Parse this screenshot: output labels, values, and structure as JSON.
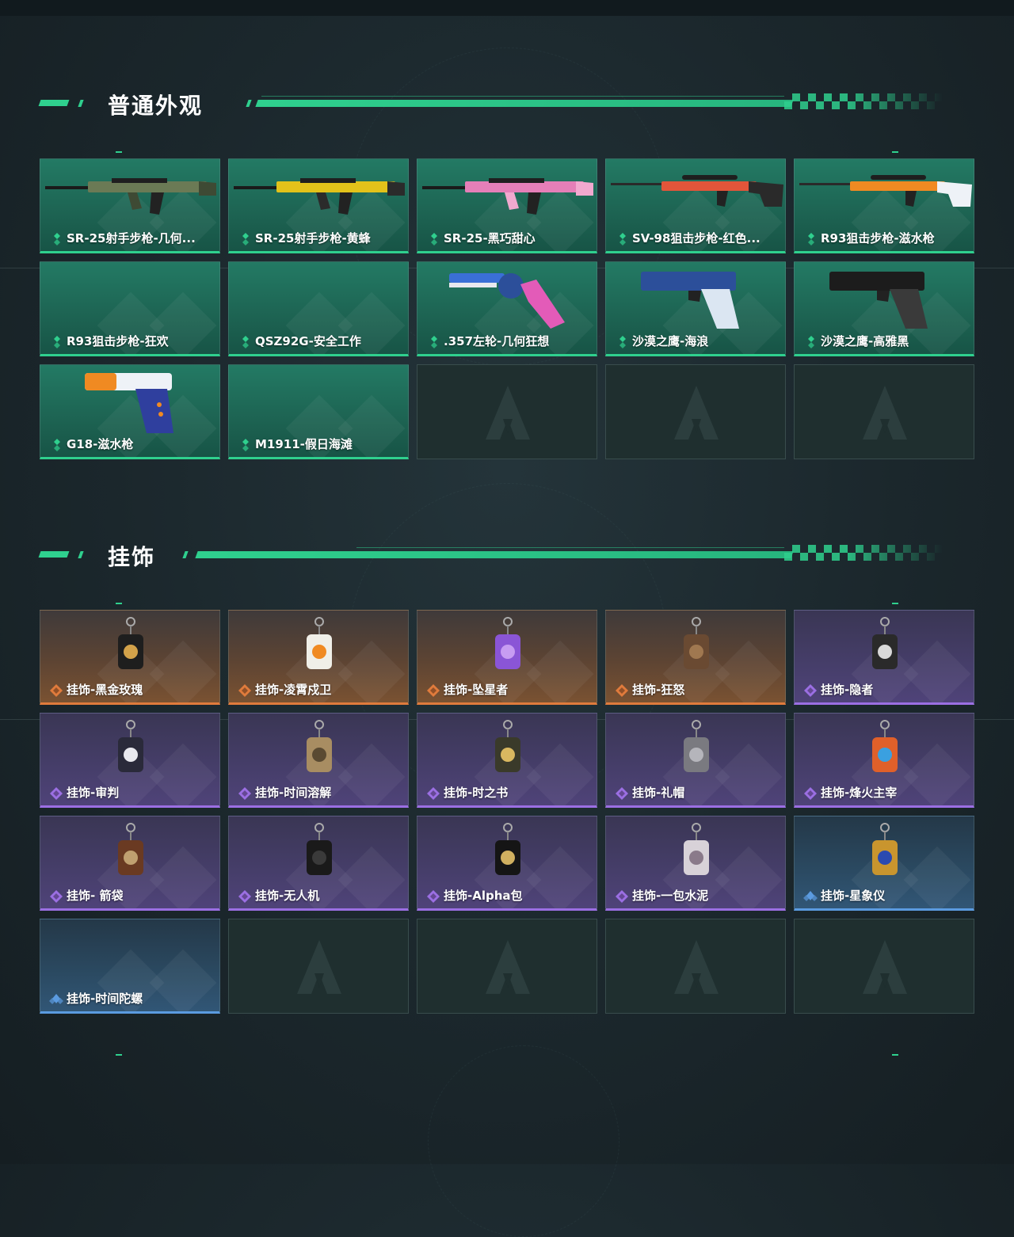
{
  "sections": [
    {
      "title": "普通外观",
      "items": [
        {
          "label": "SR-25射手步枪-几何...",
          "rarity": "green",
          "icon": "rifle-camo-icon",
          "art": "rifle",
          "colors": [
            "#6b7a55",
            "#3e4a34"
          ]
        },
        {
          "label": "SR-25射手步枪-黄蜂",
          "rarity": "green",
          "icon": "rifle-wasp-icon",
          "art": "rifle",
          "colors": [
            "#e3c21a",
            "#2b2b2b"
          ]
        },
        {
          "label": "SR-25-黑巧甜心",
          "rarity": "green",
          "icon": "rifle-pink-icon",
          "art": "rifle",
          "colors": [
            "#e57fb8",
            "#f2a9cf"
          ]
        },
        {
          "label": "SV-98狙击步枪-红色...",
          "rarity": "green",
          "icon": "sniper-red-icon",
          "art": "sniper",
          "colors": [
            "#e2553a",
            "#2a2a2a"
          ]
        },
        {
          "label": "R93狙击步枪-滋水枪",
          "rarity": "green",
          "icon": "sniper-water-icon",
          "art": "sniper",
          "colors": [
            "#f08a22",
            "#eef2f7"
          ]
        },
        {
          "label": "R93狙击步枪-狂欢",
          "rarity": "green",
          "icon": "sniper-carnival-icon",
          "art": "none",
          "colors": [
            "#000000",
            "#000000"
          ]
        },
        {
          "label": "QSZ92G-安全工作",
          "rarity": "green",
          "icon": "pistol-safety-icon",
          "art": "none",
          "colors": [
            "#000000",
            "#000000"
          ]
        },
        {
          "label": ".357左轮-几何狂想",
          "rarity": "green",
          "icon": "revolver-geometric-icon",
          "art": "revolver",
          "colors": [
            "#3a6fd6",
            "#e35bb8"
          ]
        },
        {
          "label": "沙漠之鹰-海浪",
          "rarity": "green",
          "icon": "deagle-wave-icon",
          "art": "pistol",
          "colors": [
            "#2c4f9a",
            "#dbe6f2"
          ]
        },
        {
          "label": "沙漠之鹰-高雅黑",
          "rarity": "green",
          "icon": "deagle-black-icon",
          "art": "pistol",
          "colors": [
            "#1c1c1c",
            "#3a3a3a"
          ]
        },
        {
          "label": "G18-滋水枪",
          "rarity": "green",
          "icon": "glock-water-icon",
          "art": "glock",
          "colors": [
            "#2f3f9e",
            "#f08a22"
          ]
        },
        {
          "label": "M1911-假日海滩",
          "rarity": "green",
          "icon": "m1911-beach-icon",
          "art": "none",
          "colors": [
            "#000000",
            "#000000"
          ]
        },
        {
          "label": "",
          "rarity": "empty",
          "icon": "empty-slot-icon",
          "art": "empty",
          "colors": [
            "#000000",
            "#000000"
          ]
        },
        {
          "label": "",
          "rarity": "empty",
          "icon": "empty-slot-icon",
          "art": "empty",
          "colors": [
            "#000000",
            "#000000"
          ]
        },
        {
          "label": "",
          "rarity": "empty",
          "icon": "empty-slot-icon",
          "art": "empty",
          "colors": [
            "#000000",
            "#000000"
          ]
        }
      ]
    },
    {
      "title": "挂饰",
      "items": [
        {
          "label": "挂饰-黑金玫瑰",
          "rarity": "orange",
          "icon": "charm-black-gold-rose-icon",
          "art": "charm",
          "colors": [
            "#1e1e1e",
            "#d3a24a"
          ]
        },
        {
          "label": "挂饰-凌霄戍卫",
          "rarity": "orange",
          "icon": "charm-guardian-icon",
          "art": "charm",
          "colors": [
            "#f0efe8",
            "#f08a22"
          ]
        },
        {
          "label": "挂饰-坠星者",
          "rarity": "orange",
          "icon": "charm-fallen-star-icon",
          "art": "charm",
          "colors": [
            "#8a55d6",
            "#c79cf2"
          ]
        },
        {
          "label": "挂饰-狂怒",
          "rarity": "orange",
          "icon": "charm-fury-icon",
          "art": "charm",
          "colors": [
            "#6a4a32",
            "#a07850"
          ]
        },
        {
          "label": "挂饰-隐者",
          "rarity": "purple",
          "icon": "charm-hermit-icon",
          "art": "charm",
          "colors": [
            "#2a2a2a",
            "#d9d9d9"
          ]
        },
        {
          "label": "挂饰-审判",
          "rarity": "purple",
          "icon": "charm-judgment-icon",
          "art": "charm",
          "colors": [
            "#2a2a3a",
            "#e8e8ee"
          ]
        },
        {
          "label": "挂饰-时间溶解",
          "rarity": "purple",
          "icon": "charm-time-dissolve-icon",
          "art": "charm",
          "colors": [
            "#a88d62",
            "#5a4a32"
          ]
        },
        {
          "label": "挂饰-时之书",
          "rarity": "purple",
          "icon": "charm-book-of-time-icon",
          "art": "charm",
          "colors": [
            "#3a3a2a",
            "#d9b860"
          ]
        },
        {
          "label": "挂饰-礼帽",
          "rarity": "purple",
          "icon": "charm-top-hat-icon",
          "art": "charm",
          "colors": [
            "#7a7a80",
            "#b5b5bb"
          ]
        },
        {
          "label": "挂饰-烽火主宰",
          "rarity": "purple",
          "icon": "charm-beacon-lord-icon",
          "art": "charm",
          "colors": [
            "#e0602a",
            "#3aa0e0"
          ]
        },
        {
          "label": "挂饰- 箭袋",
          "rarity": "purple",
          "icon": "charm-quiver-icon",
          "art": "charm",
          "colors": [
            "#6a3a22",
            "#c0a070"
          ]
        },
        {
          "label": "挂饰-无人机",
          "rarity": "purple",
          "icon": "charm-drone-icon",
          "art": "charm",
          "colors": [
            "#1a1a1a",
            "#3a3a3a"
          ]
        },
        {
          "label": "挂饰-Alpha包",
          "rarity": "purple",
          "icon": "charm-alpha-pack-icon",
          "art": "charm",
          "colors": [
            "#151515",
            "#d0b060"
          ]
        },
        {
          "label": "挂饰-一包水泥",
          "rarity": "purple",
          "icon": "charm-cement-bag-icon",
          "art": "charm",
          "colors": [
            "#d8d2d8",
            "#8a7a8a"
          ]
        },
        {
          "label": "挂饰-星象仪",
          "rarity": "blue",
          "icon": "charm-astrolabe-icon",
          "art": "charm",
          "colors": [
            "#c9952e",
            "#2a4ab0"
          ]
        },
        {
          "label": "挂饰-时间陀螺",
          "rarity": "blue",
          "icon": "charm-time-top-icon",
          "art": "none",
          "colors": [
            "#000000",
            "#000000"
          ]
        },
        {
          "label": "",
          "rarity": "empty",
          "icon": "empty-slot-icon",
          "art": "empty",
          "colors": [
            "#000000",
            "#000000"
          ]
        },
        {
          "label": "",
          "rarity": "empty",
          "icon": "empty-slot-icon",
          "art": "empty",
          "colors": [
            "#000000",
            "#000000"
          ]
        },
        {
          "label": "",
          "rarity": "empty",
          "icon": "empty-slot-icon",
          "art": "empty",
          "colors": [
            "#000000",
            "#000000"
          ]
        },
        {
          "label": "",
          "rarity": "empty",
          "icon": "empty-slot-icon",
          "art": "empty",
          "colors": [
            "#000000",
            "#000000"
          ]
        }
      ]
    }
  ],
  "theme": {
    "accent": "#2fd08e",
    "rarity_colors": {
      "green": "#2fd08e",
      "orange": "#e07b3c",
      "purple": "#9b6fe3",
      "blue": "#5b9be0"
    }
  }
}
